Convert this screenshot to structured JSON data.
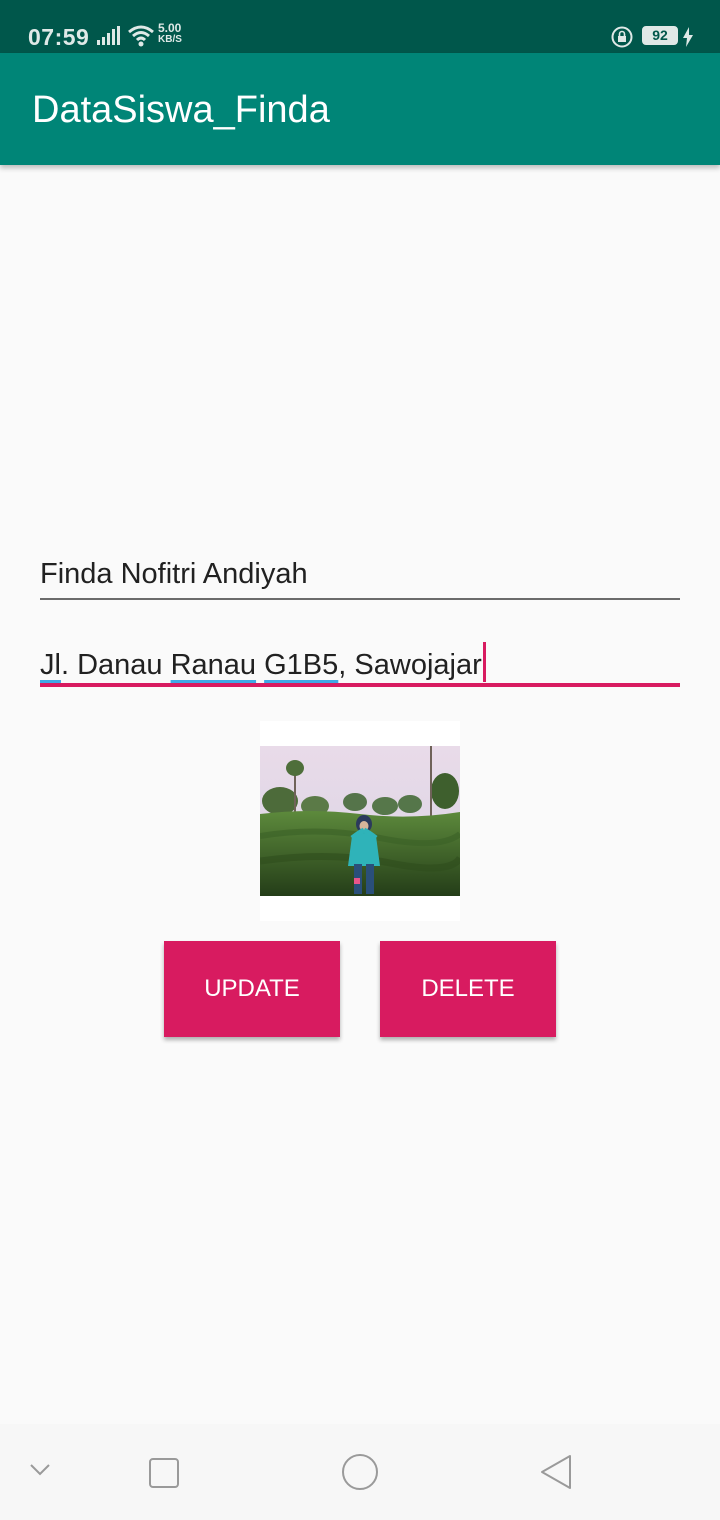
{
  "status_bar": {
    "time": "07:59",
    "net_speed_value": "5.00",
    "net_speed_unit": "KB/S",
    "battery_percent": "92",
    "icons": [
      "signal-icon",
      "wifi-icon",
      "lock-rotation-icon",
      "battery-icon",
      "charging-icon"
    ]
  },
  "app_bar": {
    "title": "DataSiswa_Finda"
  },
  "form": {
    "name_value": "Finda Nofitri Andiyah",
    "address_parts": [
      "Jl",
      ". Danau ",
      "Ranau",
      " ",
      "G1B5",
      ", Sawojajar"
    ]
  },
  "actions": {
    "update_label": "UPDATE",
    "delete_label": "DELETE"
  },
  "colors": {
    "status_bar": "#00574b",
    "app_bar": "#008577",
    "accent": "#d81b60",
    "background": "#fafafa"
  },
  "nav_bar": {
    "icons": [
      "chevron-down-icon",
      "recents-icon",
      "home-icon",
      "back-icon"
    ]
  }
}
